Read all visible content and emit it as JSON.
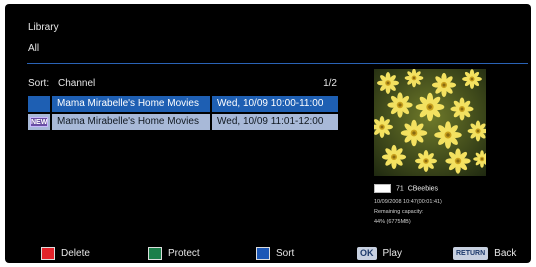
{
  "header": {
    "title": "Library",
    "subtitle": "All"
  },
  "sort": {
    "label": "Sort:",
    "value": "Channel",
    "page": "1/2"
  },
  "recordings": [
    {
      "badge": "",
      "title": "Mama Mirabelle's Home Movies",
      "date": "Wed, 10/09 10:00-11:00",
      "selected": true
    },
    {
      "badge": "NEW",
      "title": "Mama Mirabelle's Home Movies",
      "date": "Wed, 10/09 11:01-12:00",
      "selected": false
    }
  ],
  "preview": {
    "channel_number": "71",
    "channel_name": "CBeebies",
    "timestamp": "10/09/2008 10:47(00:01:41)",
    "capacity_label": "Remaining capacity:",
    "capacity_value": "44% (6775MB)"
  },
  "footer": {
    "delete": "Delete",
    "protect": "Protect",
    "sort": "Sort",
    "ok_key": "OK",
    "play": "Play",
    "return_key": "RETURN",
    "back": "Back"
  },
  "colors": {
    "red": "#e3232a",
    "green": "#1b7f4a",
    "blue": "#1c57b6",
    "highlight": "#1e5fb3",
    "row": "#a8b9d8"
  }
}
